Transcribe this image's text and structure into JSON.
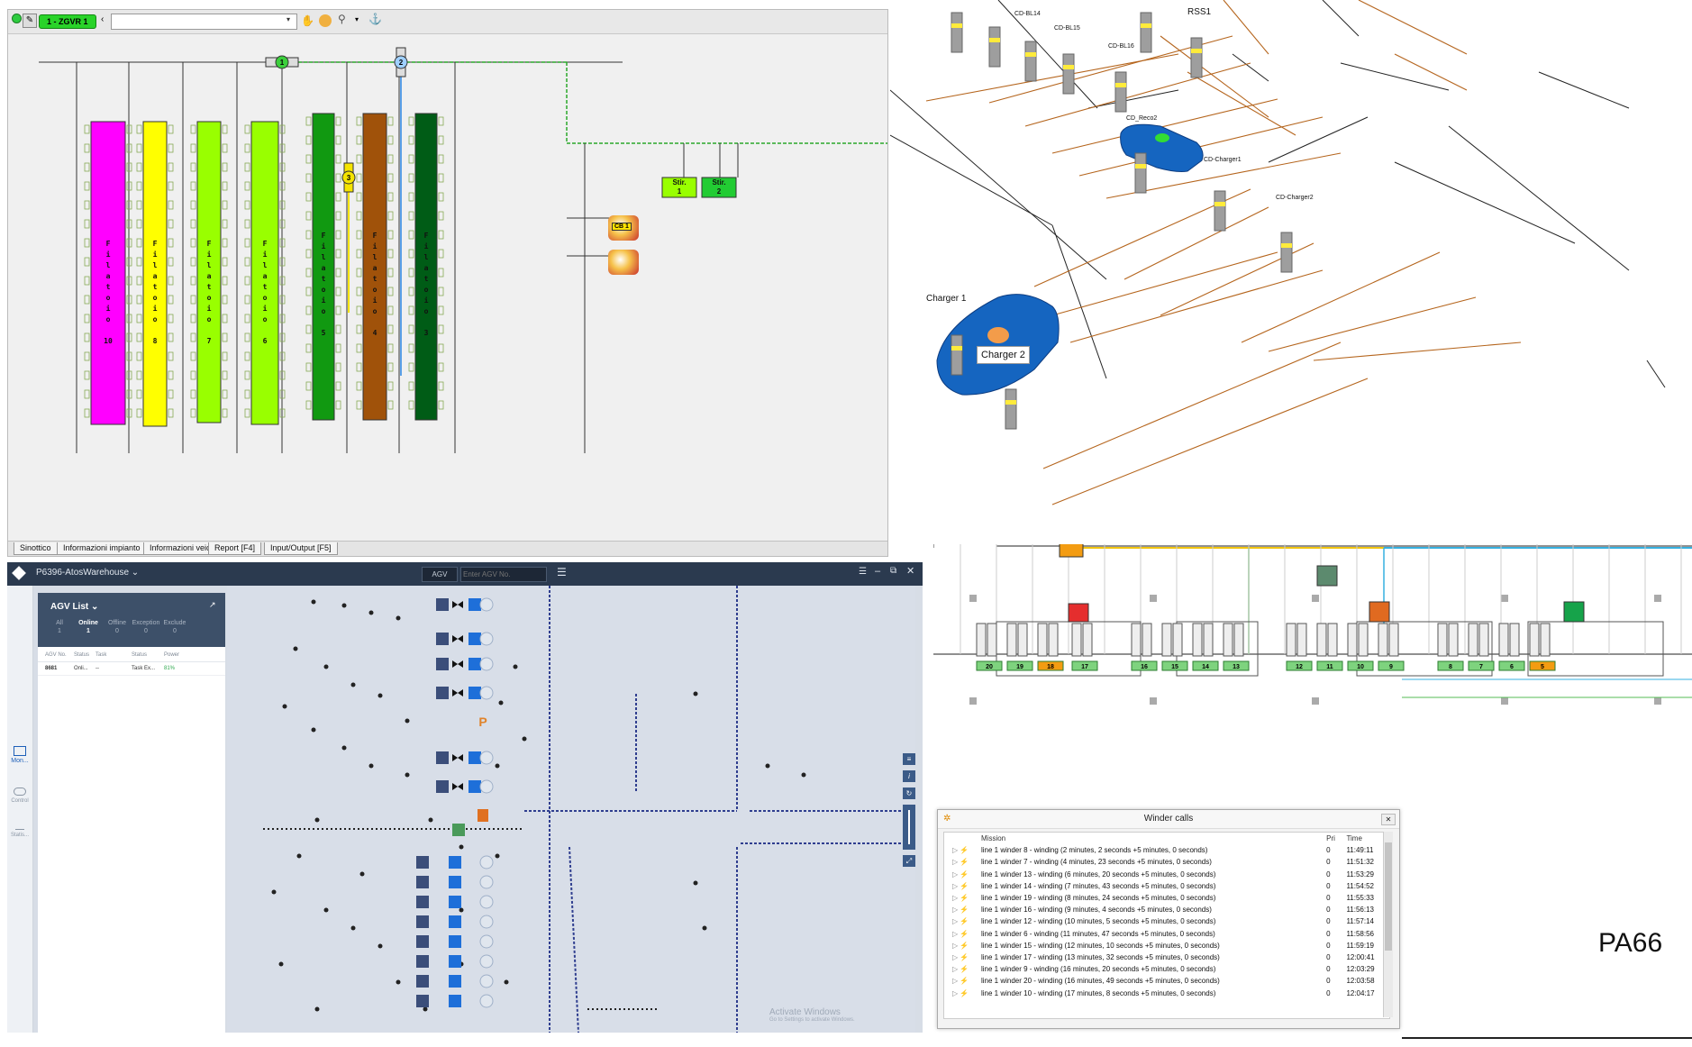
{
  "q1": {
    "toolbar": {
      "route_label": "1 - ZGVR 1",
      "route_select": ""
    },
    "vehicles": [
      "1",
      "2",
      "3"
    ],
    "machines": [
      {
        "label": "Filatoio\n\n10",
        "color": "#ff00ff"
      },
      {
        "label": "Filatoio\n\n8",
        "color": "#ffff00"
      },
      {
        "label": "Filatoio\n\n7",
        "color": "#99ff00"
      },
      {
        "label": "Filatoio\n\n6",
        "color": "#99ff00"
      },
      {
        "label": "Filatoio\n\n5",
        "color": "#119911"
      },
      {
        "label": "Filatoio\n\n4",
        "color": "#a0520a"
      },
      {
        "label": "Filatoio\n\n3",
        "color": "#005c16"
      }
    ],
    "stir": [
      "Stir.\n1",
      "Stir.\n2"
    ],
    "cb_label": "CB 1",
    "tabs": [
      "Sinottico",
      "Informazioni impianto",
      "Informazioni veicolo",
      "Report [F4]",
      "Input/Output [F5]"
    ]
  },
  "q2": {
    "labels": {
      "rss1": "RSS1",
      "cd_bl14": "CD-BL14",
      "cd_bl15": "CD-BL15",
      "cd_bl16": "CD-BL16",
      "cd_reco2": "CD_Reco2",
      "cd_charger1": "CD-Charger1",
      "cd_charger2": "CD-Charger2",
      "charger1": "Charger 1",
      "charger2": "Charger 2"
    },
    "colors": {
      "charger": "#1565c0",
      "pole": "#9e9e9e",
      "band": "#ffeb3b",
      "path": "#b5651d"
    }
  },
  "q3": {
    "project": "P6396-AtosWarehouse",
    "search_category": "AGV",
    "search_placeholder": "Enter AGV No.",
    "notification_count": "!",
    "nav": [
      "Mon...",
      "Control",
      "Statis..."
    ],
    "agv_list": {
      "title": "AGV List",
      "filters": [
        {
          "label": "All",
          "count": "1"
        },
        {
          "label": "Online",
          "count": "1"
        },
        {
          "label": "Offline",
          "count": "0"
        },
        {
          "label": "Exception",
          "count": "0"
        },
        {
          "label": "Exclude",
          "count": "0"
        }
      ],
      "columns": [
        "AGV No.",
        "Status",
        "Task",
        "Status",
        "Power"
      ],
      "rows": [
        [
          "8681",
          "Onli...",
          "--",
          "Task Ex...",
          "81%"
        ]
      ]
    },
    "station_label": "P",
    "watermark": [
      "Activate Windows",
      "Go to Settings to activate Windows."
    ]
  },
  "q4": {
    "stations": [
      "20",
      "19",
      "18",
      "17",
      "16",
      "15",
      "14",
      "13",
      "12",
      "11",
      "10",
      "9",
      "8",
      "7",
      "6",
      "5"
    ],
    "plant_label": "PA66",
    "winder_calls": {
      "title": "Winder calls",
      "columns": [
        "Mission",
        "Pri",
        "Time"
      ],
      "rows": [
        [
          "line 1 winder 8  - winding (2 minutes, 2 seconds +5 minutes, 0 seconds)",
          "0",
          "11:49:11"
        ],
        [
          "line 1 winder 7  - winding (4 minutes, 23 seconds +5 minutes, 0 seconds)",
          "0",
          "11:51:32"
        ],
        [
          "line 1 winder 13  - winding (6 minutes, 20 seconds +5 minutes, 0 seconds)",
          "0",
          "11:53:29"
        ],
        [
          "line 1 winder 14  - winding (7 minutes, 43 seconds +5 minutes, 0 seconds)",
          "0",
          "11:54:52"
        ],
        [
          "line 1 winder 19  - winding (8 minutes, 24 seconds +5 minutes, 0 seconds)",
          "0",
          "11:55:33"
        ],
        [
          "line 1 winder 16  - winding (9 minutes, 4 seconds +5 minutes, 0 seconds)",
          "0",
          "11:56:13"
        ],
        [
          "line 1 winder 12  - winding (10 minutes, 5 seconds +5 minutes, 0 seconds)",
          "0",
          "11:57:14"
        ],
        [
          "line 1 winder 6  - winding (11 minutes, 47 seconds +5 minutes, 0 seconds)",
          "0",
          "11:58:56"
        ],
        [
          "line 1 winder 15  - winding (12 minutes, 10 seconds +5 minutes, 0 seconds)",
          "0",
          "11:59:19"
        ],
        [
          "line 1 winder 17  - winding (13 minutes, 32 seconds +5 minutes, 0 seconds)",
          "0",
          "12:00:41"
        ],
        [
          "line 1 winder 9  - winding (16 minutes, 20 seconds +5 minutes, 0 seconds)",
          "0",
          "12:03:29"
        ],
        [
          "line 1 winder 20  - winding (16 minutes, 49 seconds +5 minutes, 0 seconds)",
          "0",
          "12:03:58"
        ],
        [
          "line 1 winder 10  - winding (17 minutes, 8 seconds +5 minutes, 0 seconds)",
          "0",
          "12:04:17"
        ]
      ]
    }
  }
}
